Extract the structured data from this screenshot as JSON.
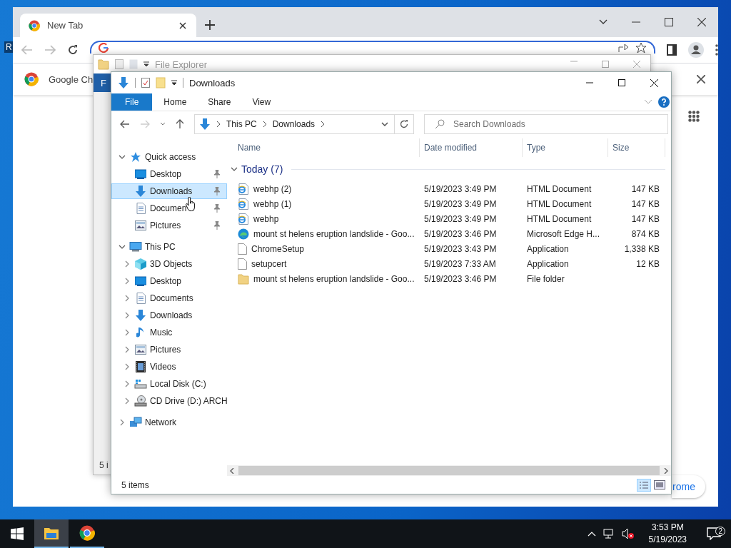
{
  "desktop": {
    "icon_label": "R"
  },
  "browser": {
    "tabs": [
      {
        "title": "New Tab",
        "selected": true
      }
    ],
    "infobar_text": "Google Ch",
    "customize_text": "rome"
  },
  "back_explorer": {
    "title": "File Explorer",
    "file_tab": "F",
    "status": "5 i"
  },
  "explorer": {
    "title": "Downloads",
    "ribbon_tabs": [
      {
        "label": "File",
        "selected": true
      },
      {
        "label": "Home",
        "selected": false
      },
      {
        "label": "Share",
        "selected": false
      },
      {
        "label": "View",
        "selected": false
      }
    ],
    "breadcrumb": [
      "This PC",
      "Downloads"
    ],
    "search": {
      "placeholder": "Search Downloads"
    },
    "nav": [
      {
        "label": "Quick access",
        "kind": "star",
        "expanded": true,
        "selected": false,
        "children": [
          {
            "label": "Desktop",
            "kind": "desktop",
            "pinned": true,
            "selected": false
          },
          {
            "label": "Downloads",
            "kind": "downloads",
            "pinned": true,
            "selected": true
          },
          {
            "label": "Documen",
            "kind": "documents",
            "pinned": true,
            "selected": false
          },
          {
            "label": "Pictures",
            "kind": "pictures",
            "pinned": true,
            "selected": false
          }
        ]
      },
      {
        "label": "This PC",
        "kind": "pc",
        "expanded": true,
        "selected": false,
        "children": [
          {
            "label": "3D Objects",
            "kind": "objects",
            "expanded": false,
            "selected": false
          },
          {
            "label": "Desktop",
            "kind": "desktop",
            "expanded": false,
            "selected": false
          },
          {
            "label": "Documents",
            "kind": "documents",
            "expanded": false,
            "selected": false
          },
          {
            "label": "Downloads",
            "kind": "downloads",
            "expanded": false,
            "selected": false
          },
          {
            "label": "Music",
            "kind": "music",
            "expanded": false,
            "selected": false
          },
          {
            "label": "Pictures",
            "kind": "pictures",
            "expanded": false,
            "selected": false
          },
          {
            "label": "Videos",
            "kind": "videos",
            "expanded": false,
            "selected": false
          },
          {
            "label": "Local Disk (C:)",
            "kind": "disk",
            "expanded": false,
            "selected": false
          },
          {
            "label": "CD Drive (D:) ARCH",
            "kind": "cd",
            "expanded": false,
            "selected": false
          }
        ]
      },
      {
        "label": "Network",
        "kind": "network",
        "expanded": false,
        "selected": false
      }
    ],
    "columns": [
      "Name",
      "Date modified",
      "Type",
      "Size"
    ],
    "group": {
      "label": "Today (7)",
      "expanded": true
    },
    "files": [
      {
        "name": "webhp (2)",
        "date": "5/19/2023 3:49 PM",
        "type": "HTML Document",
        "size": "147 KB",
        "kind": "html"
      },
      {
        "name": "webhp (1)",
        "date": "5/19/2023 3:49 PM",
        "type": "HTML Document",
        "size": "147 KB",
        "kind": "html"
      },
      {
        "name": "webhp",
        "date": "5/19/2023 3:49 PM",
        "type": "HTML Document",
        "size": "147 KB",
        "kind": "html"
      },
      {
        "name": "mount st helens eruption landslide - Goo...",
        "date": "5/19/2023 3:46 PM",
        "type": "Microsoft Edge H...",
        "size": "874 KB",
        "kind": "edge"
      },
      {
        "name": "ChromeSetup",
        "date": "5/19/2023 3:43 PM",
        "type": "Application",
        "size": "1,338 KB",
        "kind": "app"
      },
      {
        "name": "setupcert",
        "date": "5/19/2023 7:33 AM",
        "type": "Application",
        "size": "12 KB",
        "kind": "app"
      },
      {
        "name": "mount st helens eruption landslide - Goo...",
        "date": "5/19/2023 3:46 PM",
        "type": "File folder",
        "kind": "folder"
      }
    ],
    "status": "5 items"
  },
  "taskbar": {
    "apps": [
      {
        "kind": "explorer",
        "selected": true
      },
      {
        "kind": "chrome",
        "selected": false
      }
    ],
    "time": "3:53 PM",
    "date": "5/19/2023",
    "notifications": "2"
  }
}
